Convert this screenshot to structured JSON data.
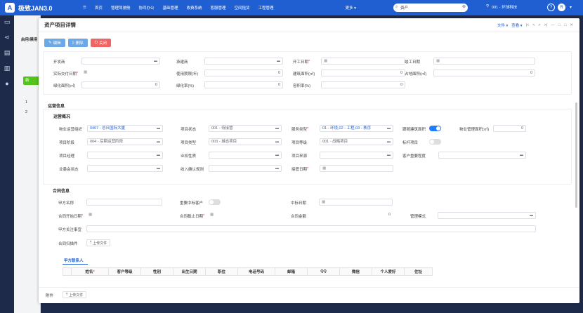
{
  "app": {
    "logo": "A",
    "name": "极致JAN3.0"
  },
  "topmenu": [
    "☰",
    "首页",
    "管理驾驶舱",
    "协同办公",
    "基础管理",
    "收费系统",
    "客服管理",
    "空间租赁",
    "工程管理"
  ],
  "more_label": "更多 ▾",
  "search": {
    "value": "资产"
  },
  "org": "001 - 环球科技",
  "avatar_letter": "R",
  "sidebar_bg": {
    "label": "启用/禁用",
    "add_btn": "新",
    "rows": [
      "1",
      "2"
    ]
  },
  "modal": {
    "title": "资产项目详情",
    "tools": {
      "file": "文件 ▾",
      "view": "查看 ▾",
      "nav": [
        "|<",
        "<",
        ">",
        ">|"
      ],
      "win": [
        "—",
        "□",
        "□",
        "✕"
      ]
    },
    "actions": {
      "edit": "编辑",
      "delete": "删除",
      "close": "关闭"
    }
  },
  "basic": {
    "developer": "开发商",
    "contractor": "承建商",
    "start_date": "开工日期",
    "finish_date": "竣工日期",
    "delivery_date": "实际交付日期",
    "years": "使用期限(年)",
    "years_val": "0",
    "build_area": "建筑面积(㎡)",
    "build_area_val": "0",
    "land_area": "占地面积(㎡)",
    "land_area_val": "0",
    "green_area": "绿化面积(㎡)",
    "green_area_val": "0",
    "green_rate": "绿化率(%)",
    "green_rate_val": "0",
    "volume_rate": "容积率(%)",
    "volume_rate_val": "0"
  },
  "ops": {
    "section": "运营信息",
    "overview": "运营概况",
    "org_label": "物业运营组织",
    "org_val": "0407 - 总日国际大厦",
    "status_label": "项目状态",
    "status_val": "001 - 待接管",
    "service_label": "服务类型",
    "service_val": "01 - 环境,02 - 工程,03 - 秩序",
    "follow_label": "跟随建筑面积",
    "mgmt_area_label": "物业管理面积(㎡)",
    "mgmt_area_val": "0",
    "stage_label": "项目阶段",
    "stage_val": "004 - 后期运营阶段",
    "type_label": "项目类型",
    "type_val": "003 - 城态项目",
    "grade_label": "项目等级",
    "grade_val": "001 - 战略项目",
    "bench_label": "标杆项目",
    "manager_label": "项目经理",
    "nature_label": "业权性质",
    "source_label": "项目来源",
    "importance_label": "客户重要程度",
    "owner_label": "业委会状态",
    "income_label": "收入确认规则",
    "takeover_label": "接管日期"
  },
  "contract": {
    "section": "合同信息",
    "partyA": "甲方名称",
    "important": "重要中标客户",
    "bid_date": "中标日期",
    "start": "合同开始日期",
    "end": "合同截止日期",
    "amount": "合同金额",
    "amount_val": "0",
    "mgmt_mode": "管理模式",
    "focus": "甲方关注事宜",
    "scan": "合同扫描件",
    "upload": "上传文件",
    "tab": "甲方联系人",
    "columns": [
      "",
      "姓名",
      "客户等级",
      "性别",
      "出生日期",
      "职位",
      "电话号码",
      "邮箱",
      "QQ",
      "微信",
      "个人爱好",
      "住址"
    ]
  },
  "footer": {
    "attach": "附件",
    "upload": "上传文件"
  }
}
